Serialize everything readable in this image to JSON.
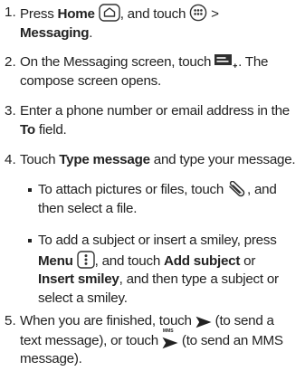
{
  "steps": [
    {
      "number": "1.",
      "parts": {
        "a": "Press ",
        "b": "Home",
        "c": ", and touch ",
        "d": " >",
        "e": "Messaging",
        "f": "."
      },
      "icons": [
        "home-key-icon",
        "apps-grid-icon"
      ]
    },
    {
      "number": "2.",
      "parts": {
        "a": "On the Messaging screen, touch ",
        "b": ". The",
        "c": "compose screen opens."
      },
      "icons": [
        "compose-message-icon"
      ]
    },
    {
      "number": "3.",
      "parts": {
        "a": "Enter a phone number or email address in the",
        "b": "To",
        "c": " field."
      }
    },
    {
      "number": "4.",
      "parts": {
        "a": "Touch ",
        "b": "Type message",
        "c": " and type your message."
      },
      "bullets": [
        {
          "parts": {
            "a": "To attach pictures or files, touch ",
            "b": ", and",
            "c": "then select a file."
          },
          "icons": [
            "paperclip-icon"
          ]
        },
        {
          "parts": {
            "a": "To add a subject or insert a smiley, press",
            "b": "Menu",
            "c": ", and touch ",
            "d": "Add subject",
            "e": " or",
            "f": "Insert smiley",
            "g": ", and then type a subject or",
            "h": "select a smiley."
          },
          "icons": [
            "menu-key-icon"
          ]
        }
      ]
    },
    {
      "number": "5.",
      "parts": {
        "a": "When you are finished, touch ",
        "b": " (to send a",
        "c": "text message), or touch ",
        "d": " (to send an MMS",
        "e": "message)."
      },
      "icons": [
        "send-icon",
        "send-mms-icon"
      ],
      "mms_label": "MMS"
    }
  ]
}
